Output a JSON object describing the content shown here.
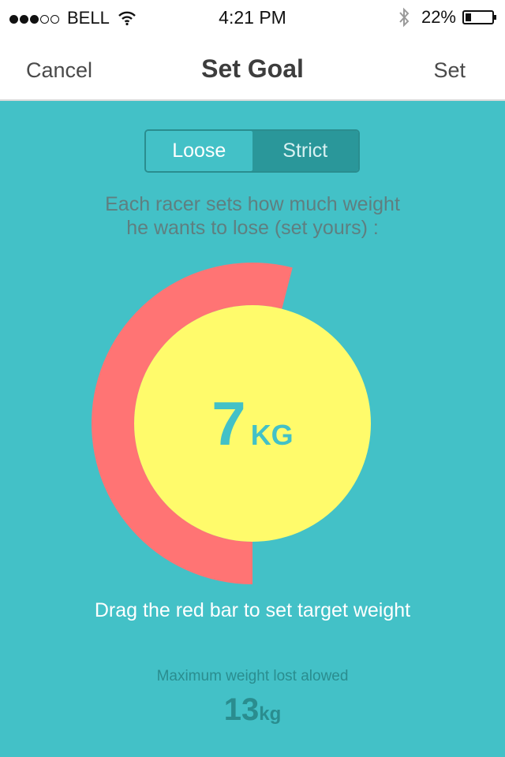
{
  "status_bar": {
    "carrier": "BELL",
    "time": "4:21 PM",
    "battery_percent_label": "22%",
    "battery_level": 0.22,
    "signal_bars_filled": 3,
    "signal_bars_total": 5,
    "icons": [
      "wifi-icon",
      "bluetooth-icon",
      "battery-icon"
    ]
  },
  "nav": {
    "cancel_label": "Cancel",
    "title": "Set Goal",
    "set_label": "Set"
  },
  "mode_toggle": {
    "options": [
      "Loose",
      "Strict"
    ],
    "selected": "Loose"
  },
  "instructions": {
    "line1": "Each racer sets how much weight",
    "line2": "he wants to lose (set yours) :"
  },
  "goal": {
    "value": "7",
    "unit": "KG",
    "fraction_of_max": 0.54
  },
  "hint": "Drag the red bar to set target weight",
  "maximum": {
    "label": "Maximum weight lost alowed",
    "value": "13",
    "unit": "kg"
  },
  "colors": {
    "background": "#43c1c7",
    "ring": "#ff7474",
    "dial_center": "#fffb6b",
    "accent_text": "#2a8d8f"
  }
}
